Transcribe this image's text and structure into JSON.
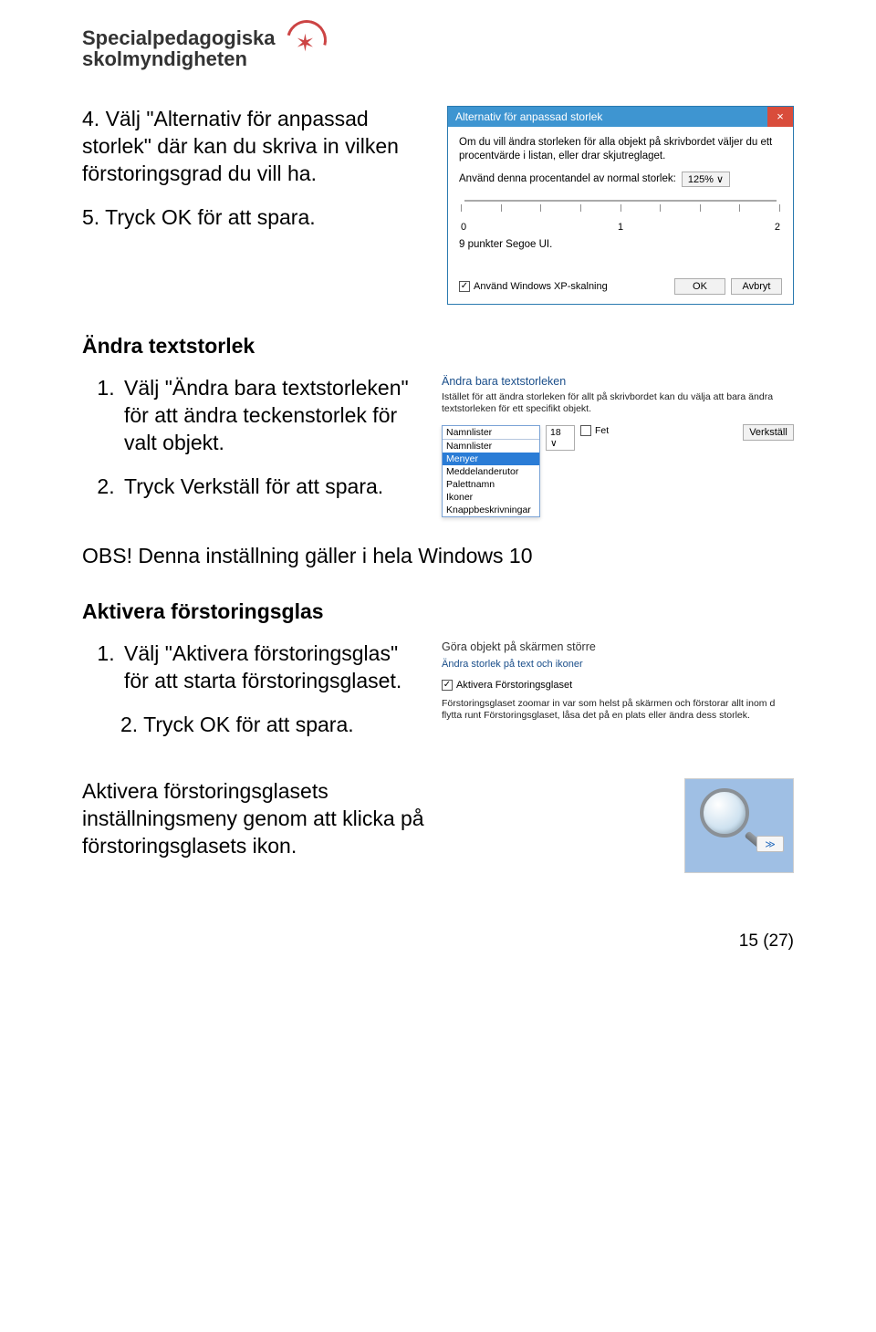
{
  "logo": {
    "line1": "Specialpedagogiska",
    "line2": "skolmyndigheten"
  },
  "sec1": {
    "p4": "4. Välj \"Alternativ för anpassad storlek\" där kan du skriva in vilken förstoringsgrad du vill ha.",
    "p5": "5. Tryck OK för att spara."
  },
  "dialog": {
    "title": "Alternativ för anpassad storlek",
    "desc": "Om du vill ändra storleken för alla objekt på skrivbordet väljer du ett procentvärde i listan, eller drar skjutreglaget.",
    "row_label": "Använd denna procentandel av normal storlek:",
    "percent": "125%",
    "tick0": "0",
    "tick1": "1",
    "tick2": "2",
    "sample": "9 punkter Segoe UI.",
    "xp_label": "Använd Windows XP-skalning",
    "ok": "OK",
    "cancel": "Avbryt"
  },
  "sec2": {
    "heading": "Ändra textstorlek",
    "p1": "Välj \"Ändra bara textstorleken\" för att ändra teckenstorlek för valt objekt.",
    "p2": "Tryck Verkställ för att spara."
  },
  "ts": {
    "heading": "Ändra bara textstorleken",
    "desc": "Istället för att ändra storleken för allt på skrivbordet kan du välja att bara ändra textstorleken för ett specifikt objekt.",
    "selected": "Namnlister",
    "options": [
      "Namnlister",
      "Menyer",
      "Meddelanderutor",
      "Palettnamn",
      "Ikoner",
      "Knappbeskrivningar"
    ],
    "size": "18",
    "fet": "Fet",
    "verkstall": "Verkställ"
  },
  "note": "OBS! Denna inställning gäller i hela Windows 10",
  "sec3": {
    "heading": "Aktivera förstoringsglas",
    "li1": "Välj \"Aktivera förstoringsglas\" för att starta förstoringsglaset.",
    "li2": "2. Tryck OK för att spara."
  },
  "mg": {
    "heading": "Göra objekt på skärmen större",
    "link": "Ändra storlek på text och ikoner",
    "cb_label": "Aktivera Förstoringsglaset",
    "desc": "Förstoringsglaset zoomar in var som helst på skärmen och förstorar allt inom d flytta runt Förstoringsglaset, låsa det på en plats eller ändra dess storlek."
  },
  "sec4": "Aktivera förstoringsglasets inställningsmeny genom att klicka på förstoringsglasets ikon.",
  "mg_chip": "≫",
  "page_num": "15 (27)"
}
